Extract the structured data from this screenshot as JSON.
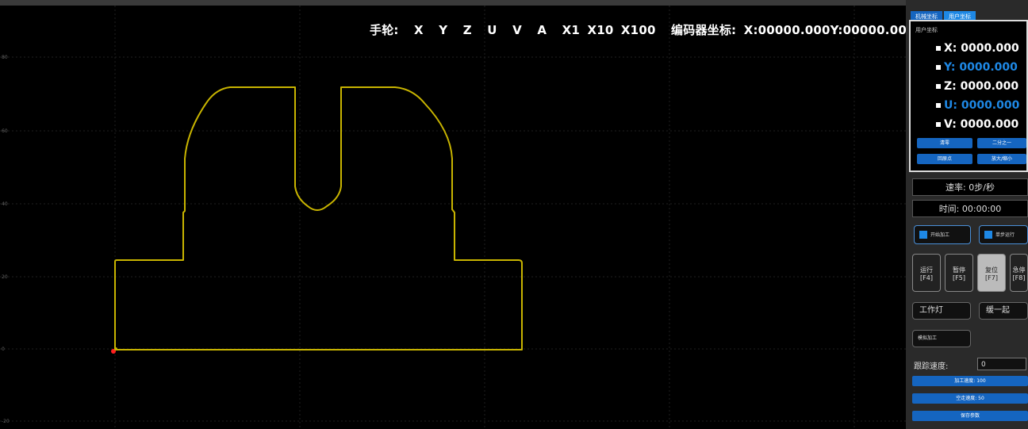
{
  "hud": {
    "handwheel_label": "手轮:",
    "axes": [
      "X",
      "Y",
      "Z",
      "U",
      "V",
      "A"
    ],
    "multipliers": [
      "X1",
      "X10",
      "X100"
    ],
    "encoder_label": "编码器坐标:",
    "encoder_x": "X:00000.000",
    "encoder_y": "Y:00000.000"
  },
  "tabs": [
    "机械坐标",
    "用户坐标"
  ],
  "coords": {
    "caption": "用户坐标",
    "rows": [
      {
        "label": "X: 0000.000",
        "color": "#ffffff"
      },
      {
        "label": "Y: 0000.000",
        "color": "#1e88e5"
      },
      {
        "label": "Z: 0000.000",
        "color": "#ffffff"
      },
      {
        "label": "U: 0000.000",
        "color": "#1e88e5"
      },
      {
        "label": "V: 0000.000",
        "color": "#ffffff"
      }
    ],
    "buttons": [
      "清零",
      "二分之一",
      "回原点",
      "放大/缩小"
    ]
  },
  "status": {
    "speed": "速率: 0步/秒",
    "time": "时间: 00:00:00"
  },
  "control_buttons": [
    "开始加工",
    "单步运行"
  ],
  "mode_buttons": [
    {
      "label": "运行",
      "key": "[F4]"
    },
    {
      "label": "暂停",
      "key": "[F5]"
    },
    {
      "label": "复位",
      "key": "[F7]"
    },
    {
      "label": "急停",
      "key": "[F8]"
    }
  ],
  "toggle_buttons": [
    "工作灯",
    "缓一起"
  ],
  "extra_button": "模拟加工",
  "speed_input": {
    "label": "跟踪速度:",
    "value": "0"
  },
  "bar_buttons": [
    "加工速度: 100",
    "空走速度: 50",
    "保存参数"
  ],
  "y_ticks": [
    "80",
    "60",
    "40",
    "20",
    "0",
    "-20"
  ],
  "colors": {
    "path": "#c8b400",
    "accent": "#1e88e5",
    "origin": "#ff2020"
  }
}
